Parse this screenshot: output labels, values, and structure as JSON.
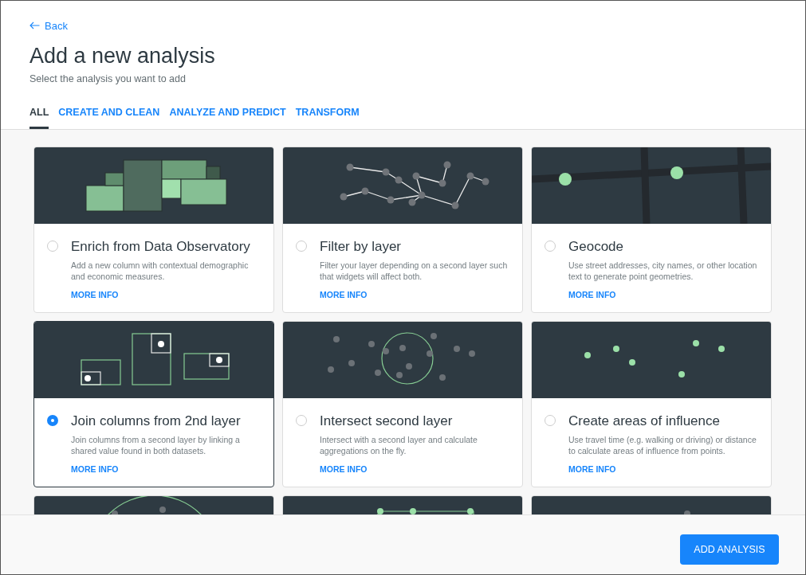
{
  "back": {
    "label": "Back"
  },
  "title": "Add a new analysis",
  "subtitle": "Select the analysis you want to add",
  "tabs": [
    {
      "label": "ALL",
      "selected": true
    },
    {
      "label": "CREATE AND CLEAN",
      "selected": false
    },
    {
      "label": "ANALYZE AND PREDICT",
      "selected": false
    },
    {
      "label": "TRANSFORM",
      "selected": false
    }
  ],
  "cards": [
    {
      "kind": "enrich",
      "title": "Enrich from Data Observatory",
      "description": "Add a new column with contextual demographic and economic measures.",
      "link": "MORE INFO",
      "selected": false
    },
    {
      "kind": "filter",
      "title": "Filter by layer",
      "description": "Filter your layer depending on a second layer such that widgets will affect both.",
      "link": "MORE INFO",
      "selected": false
    },
    {
      "kind": "geocode",
      "title": "Geocode",
      "description": "Use street addresses, city names, or other location text to generate point geometries.",
      "link": "MORE INFO",
      "selected": false
    },
    {
      "kind": "join",
      "title": "Join columns from 2nd layer",
      "description": "Join columns from a second layer by linking a shared value found in both datasets.",
      "link": "MORE INFO",
      "selected": true
    },
    {
      "kind": "intersect",
      "title": "Intersect second layer",
      "description": "Intersect with a second layer and calculate aggregations on the fly.",
      "link": "MORE INFO",
      "selected": false
    },
    {
      "kind": "influence",
      "title": "Create areas of influence",
      "description": "Use travel time (e.g. walking or driving) or distance to calculate areas of influence from points.",
      "link": "MORE INFO",
      "selected": false
    },
    {
      "kind": "circle"
    },
    {
      "kind": "polygon"
    },
    {
      "kind": "points"
    }
  ],
  "action": {
    "label": "ADD ANALYSIS"
  }
}
